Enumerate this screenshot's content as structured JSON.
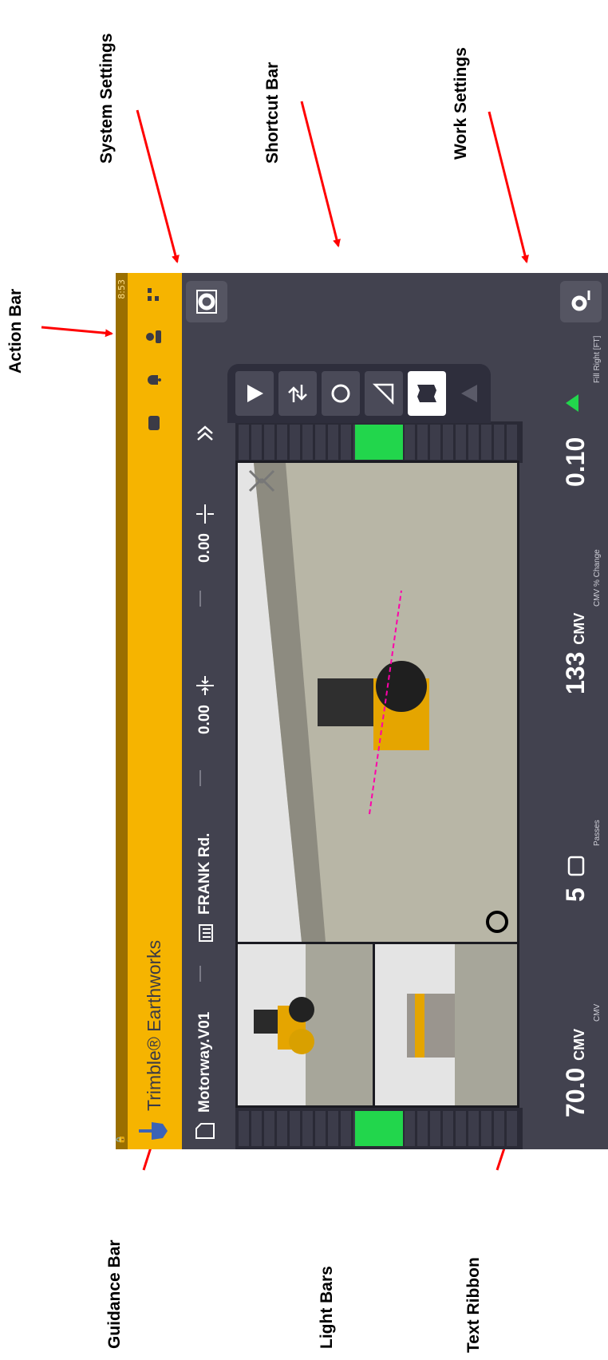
{
  "callouts": {
    "system_settings": "System Settings",
    "shortcut_bar": "Shortcut Bar",
    "work_settings": "Work Settings",
    "action_bar": "Action Bar",
    "guidance_bar": "Guidance Bar",
    "light_bars": "Light Bars",
    "text_ribbon": "Text Ribbon"
  },
  "status": {
    "time": "8:53"
  },
  "app": {
    "brand": "Trimble® Earthworks"
  },
  "guidance": {
    "design": "Motorway.V01",
    "road": "FRANK Rd.",
    "offset_1": "0.00",
    "offset_2": "0.00"
  },
  "ribbon": {
    "cmv_value": "70.0",
    "cmv_unit": "CMV",
    "cmv_label": "CMV",
    "passes_value": "5",
    "passes_label": "Passes",
    "cmv_change_value": "133",
    "cmv_change_unit": "CMV",
    "cmv_change_label": "CMV % Change",
    "fill_value": "0.10",
    "fill_label": "Fill Right  [FT]"
  },
  "colors": {
    "action_bar": "#f6b400",
    "panel": "#42424f",
    "arrow": "#ff0000",
    "lightbar_on": "#22d64c"
  }
}
